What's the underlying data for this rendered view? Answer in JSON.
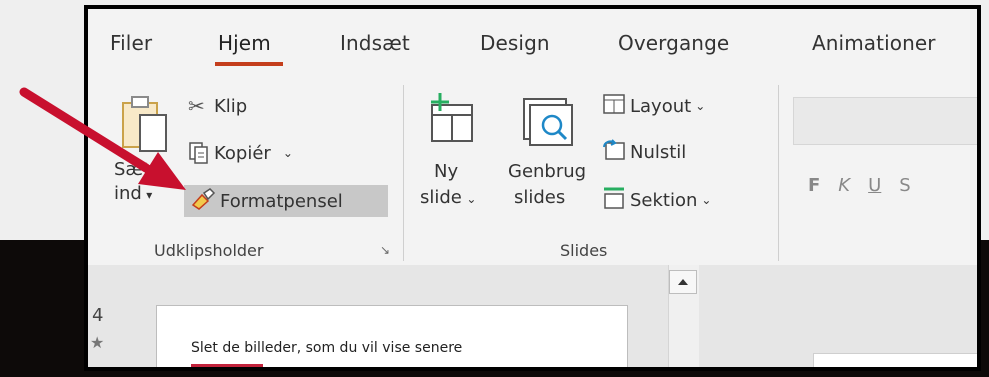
{
  "tabs": [
    "Filer",
    "Hjem",
    "Indsæt",
    "Design",
    "Overgange",
    "Animationer"
  ],
  "active_tab": "Hjem",
  "accent_color": "#c43e1c",
  "clipboard": {
    "paste_label_top": "Sæt",
    "paste_label_bottom": "ind",
    "cut_label": "Klip",
    "copy_label": "Kopiér",
    "format_painter_label": "Formatpensel",
    "group_label": "Udklipsholder"
  },
  "slides_group": {
    "new_slide_line1": "Ny",
    "new_slide_line2": "slide",
    "reuse_line1": "Genbrug",
    "reuse_line2": "slides",
    "layout_label": "Layout",
    "reset_label": "Nulstil",
    "section_label": "Sektion",
    "group_label": "Slides"
  },
  "font_group": {
    "bold": "F",
    "italic": "K",
    "underline": "U",
    "strike": "S"
  },
  "thumbnails": {
    "slide_number": "4",
    "slide_title": "Slet de billeder, som du vil vise senere"
  },
  "annotation": {
    "arrow_color": "#c8102e"
  }
}
